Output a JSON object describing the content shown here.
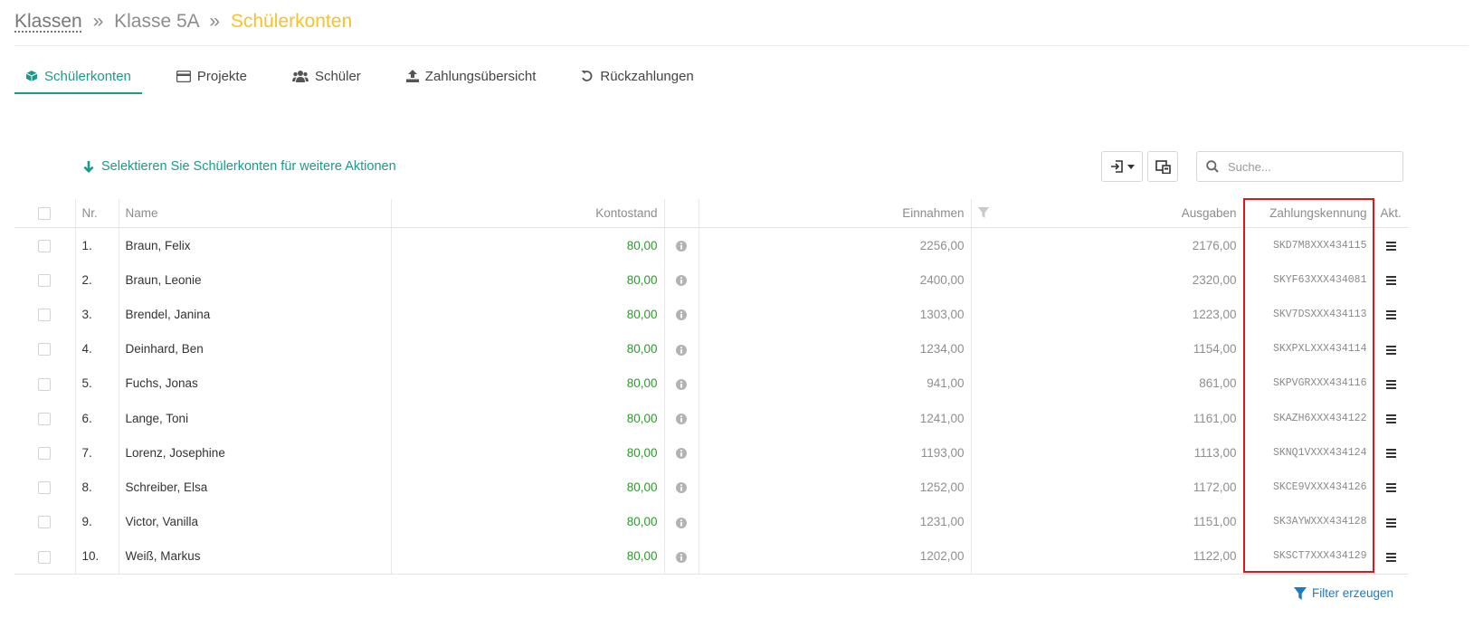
{
  "breadcrumb": {
    "root": "Klassen",
    "separator": "»",
    "middle": "Klasse 5A",
    "current": "Schülerkonten"
  },
  "tabs": [
    {
      "label": "Schülerkonten",
      "icon": "cube-icon",
      "active": true
    },
    {
      "label": "Projekte",
      "icon": "credit-card-icon",
      "active": false
    },
    {
      "label": "Schüler",
      "icon": "users-icon",
      "active": false
    },
    {
      "label": "Zahlungsübersicht",
      "icon": "upload-icon",
      "active": false
    },
    {
      "label": "Rückzahlungen",
      "icon": "undo-icon",
      "active": false
    }
  ],
  "toolbar": {
    "select_hint": "Selektieren Sie Schülerkonten für weitere Aktionen"
  },
  "search": {
    "placeholder": "Suche..."
  },
  "table": {
    "headers": {
      "nr": "Nr.",
      "name": "Name",
      "balance": "Kontostand",
      "income": "Einnahmen",
      "expenses": "Ausgaben",
      "reference": "Zahlungskennung",
      "actions": "Akt."
    },
    "rows": [
      {
        "nr": "1.",
        "name": "Braun, Felix",
        "balance": "80,00",
        "income": "2256,00",
        "expenses": "2176,00",
        "reference": "SKD7M8XXX434115"
      },
      {
        "nr": "2.",
        "name": "Braun, Leonie",
        "balance": "80,00",
        "income": "2400,00",
        "expenses": "2320,00",
        "reference": "SKYF63XXX434081"
      },
      {
        "nr": "3.",
        "name": "Brendel, Janina",
        "balance": "80,00",
        "income": "1303,00",
        "expenses": "1223,00",
        "reference": "SKV7DSXXX434113"
      },
      {
        "nr": "4.",
        "name": "Deinhard, Ben",
        "balance": "80,00",
        "income": "1234,00",
        "expenses": "1154,00",
        "reference": "SKXPXLXXX434114"
      },
      {
        "nr": "5.",
        "name": "Fuchs, Jonas",
        "balance": "80,00",
        "income": "941,00",
        "expenses": "861,00",
        "reference": "SKPVGRXXX434116"
      },
      {
        "nr": "6.",
        "name": "Lange, Toni",
        "balance": "80,00",
        "income": "1241,00",
        "expenses": "1161,00",
        "reference": "SKAZH6XXX434122"
      },
      {
        "nr": "7.",
        "name": "Lorenz, Josephine",
        "balance": "80,00",
        "income": "1193,00",
        "expenses": "1113,00",
        "reference": "SKNQ1VXXX434124"
      },
      {
        "nr": "8.",
        "name": "Schreiber, Elsa",
        "balance": "80,00",
        "income": "1252,00",
        "expenses": "1172,00",
        "reference": "SKCE9VXXX434126"
      },
      {
        "nr": "9.",
        "name": "Victor, Vanilla",
        "balance": "80,00",
        "income": "1231,00",
        "expenses": "1151,00",
        "reference": "SK3AYWXXX434128"
      },
      {
        "nr": "10.",
        "name": "Weiß, Markus",
        "balance": "80,00",
        "income": "1202,00",
        "expenses": "1122,00",
        "reference": "SKSCT7XXX434129"
      }
    ]
  },
  "footer": {
    "filter_label": "Filter erzeugen"
  },
  "colors": {
    "accent": "#1b9a8b",
    "breadcrumb_current": "#f5c22a",
    "balance_positive": "#2c9a2c",
    "link": "#1b7bc4",
    "highlight": "#e3141a"
  }
}
